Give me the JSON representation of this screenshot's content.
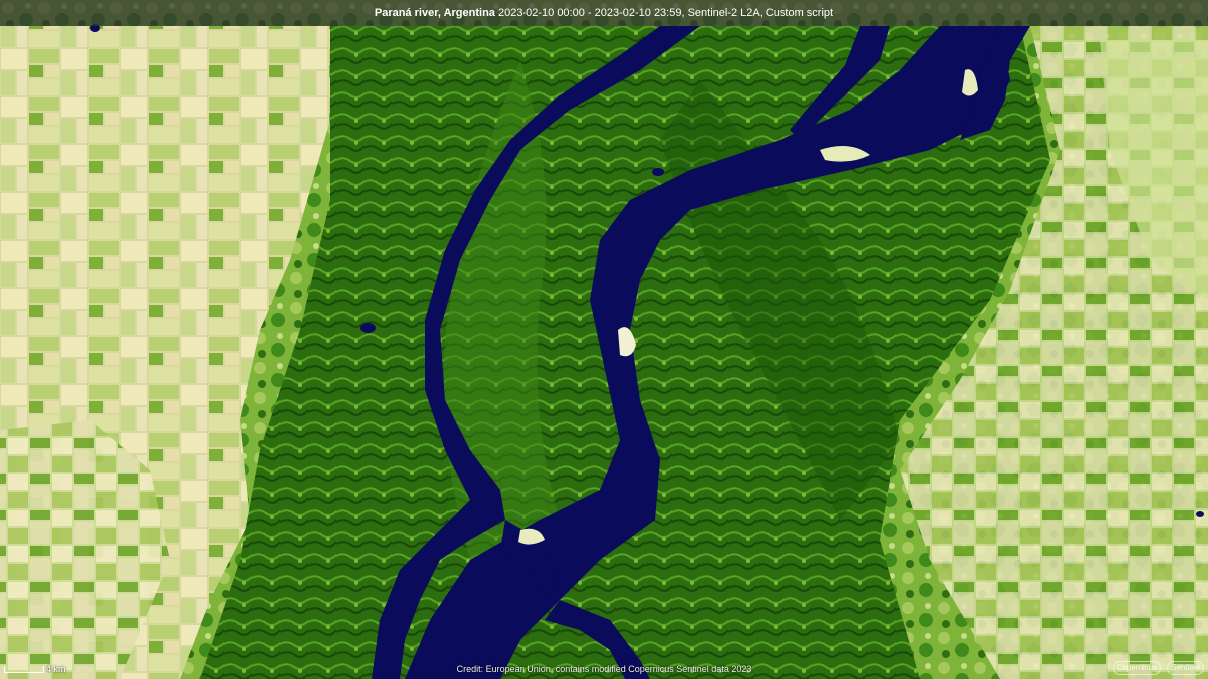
{
  "title": {
    "place": "Paraná river, Argentina",
    "details": " 2023-02-10 00:00 - 2023-02-10 23:59, Sentinel-2 L2A, Custom script"
  },
  "scale": {
    "label": "4 km"
  },
  "credits": {
    "text": "Credit: European Union, contains modified Copernicus Sentinel data 2023"
  },
  "logos": {
    "left": "Copernicus",
    "right": "Sentinel"
  },
  "colors": {
    "water": "#0b0b5c",
    "dense_vegetation": "#1f5e0a",
    "vegetation": "#4e9a1c",
    "sparse_vegetation": "#a8cc60",
    "bare_fields": "#e8e2b0"
  }
}
